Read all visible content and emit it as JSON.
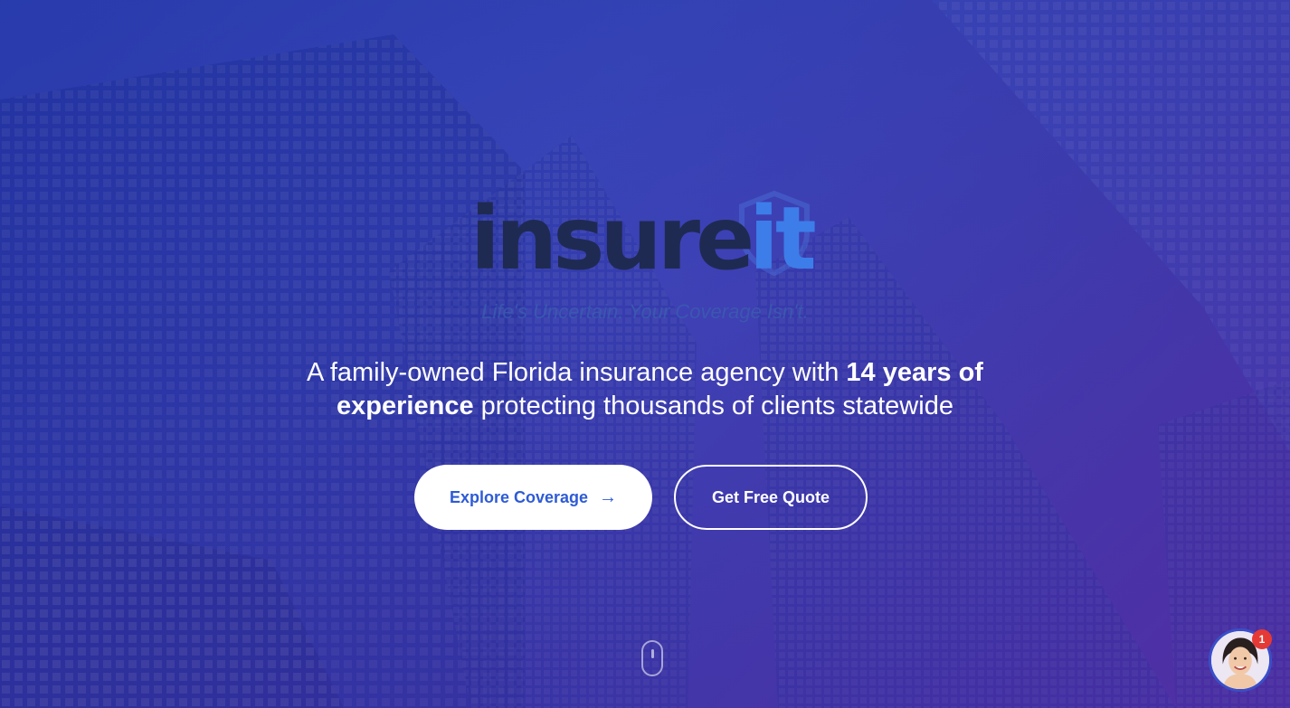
{
  "brand": {
    "word": "insure",
    "accent": "it",
    "tagline": "Life's Uncertain. Your Coverage Isn't."
  },
  "hero": {
    "subhead_part1": "A family-owned Florida insurance agency with ",
    "subhead_bold": "14 years of experience",
    "subhead_part2": " protecting thousands of clients statewide"
  },
  "buttons": {
    "primary_label": "Explore Coverage",
    "primary_icon": "arrow-right-icon",
    "secondary_label": "Get Free Quote"
  },
  "chat": {
    "badge_count": "1",
    "avatar_icon": "support-agent-avatar"
  },
  "colors": {
    "accent": "#3d7dea",
    "logo_dark": "#1f2a52",
    "primary_button_text": "#2e5bd6",
    "badge": "#e53935"
  }
}
